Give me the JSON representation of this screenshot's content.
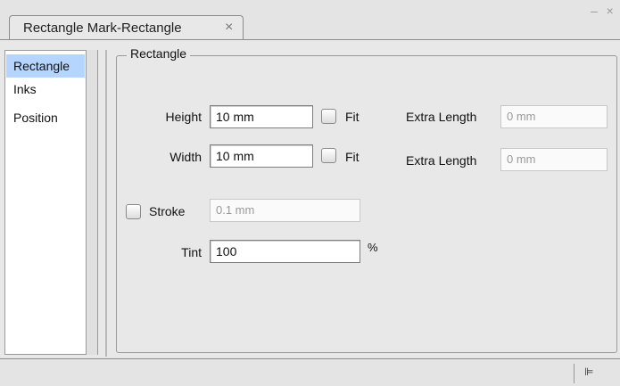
{
  "panel": {
    "tab_title": "Rectangle Mark-Rectangle",
    "close_glyph": "×",
    "window_buttons": "– ×"
  },
  "sidebar": {
    "items": [
      {
        "label": "Rectangle",
        "selected": true
      },
      {
        "label": "Inks",
        "selected": false
      },
      {
        "label": "Position",
        "selected": false
      }
    ]
  },
  "group": {
    "title": "Rectangle",
    "height": {
      "label": "Height",
      "value": "10 mm",
      "fit_label": "Fit",
      "fit_checked": false,
      "extra_label": "Extra Length",
      "extra_value": "0 mm"
    },
    "width": {
      "label": "Width",
      "value": "10 mm",
      "fit_label": "Fit",
      "fit_checked": false,
      "extra_label": "Extra Length",
      "extra_value": "0 mm"
    },
    "stroke": {
      "label": "Stroke",
      "checked": false,
      "value": "0.1 mm"
    },
    "tint": {
      "label": "Tint",
      "value": "100",
      "unit": "%"
    }
  },
  "status_bar": {
    "menu_icon": "flyout-menu-icon",
    "menu_glyph": "⊫"
  }
}
